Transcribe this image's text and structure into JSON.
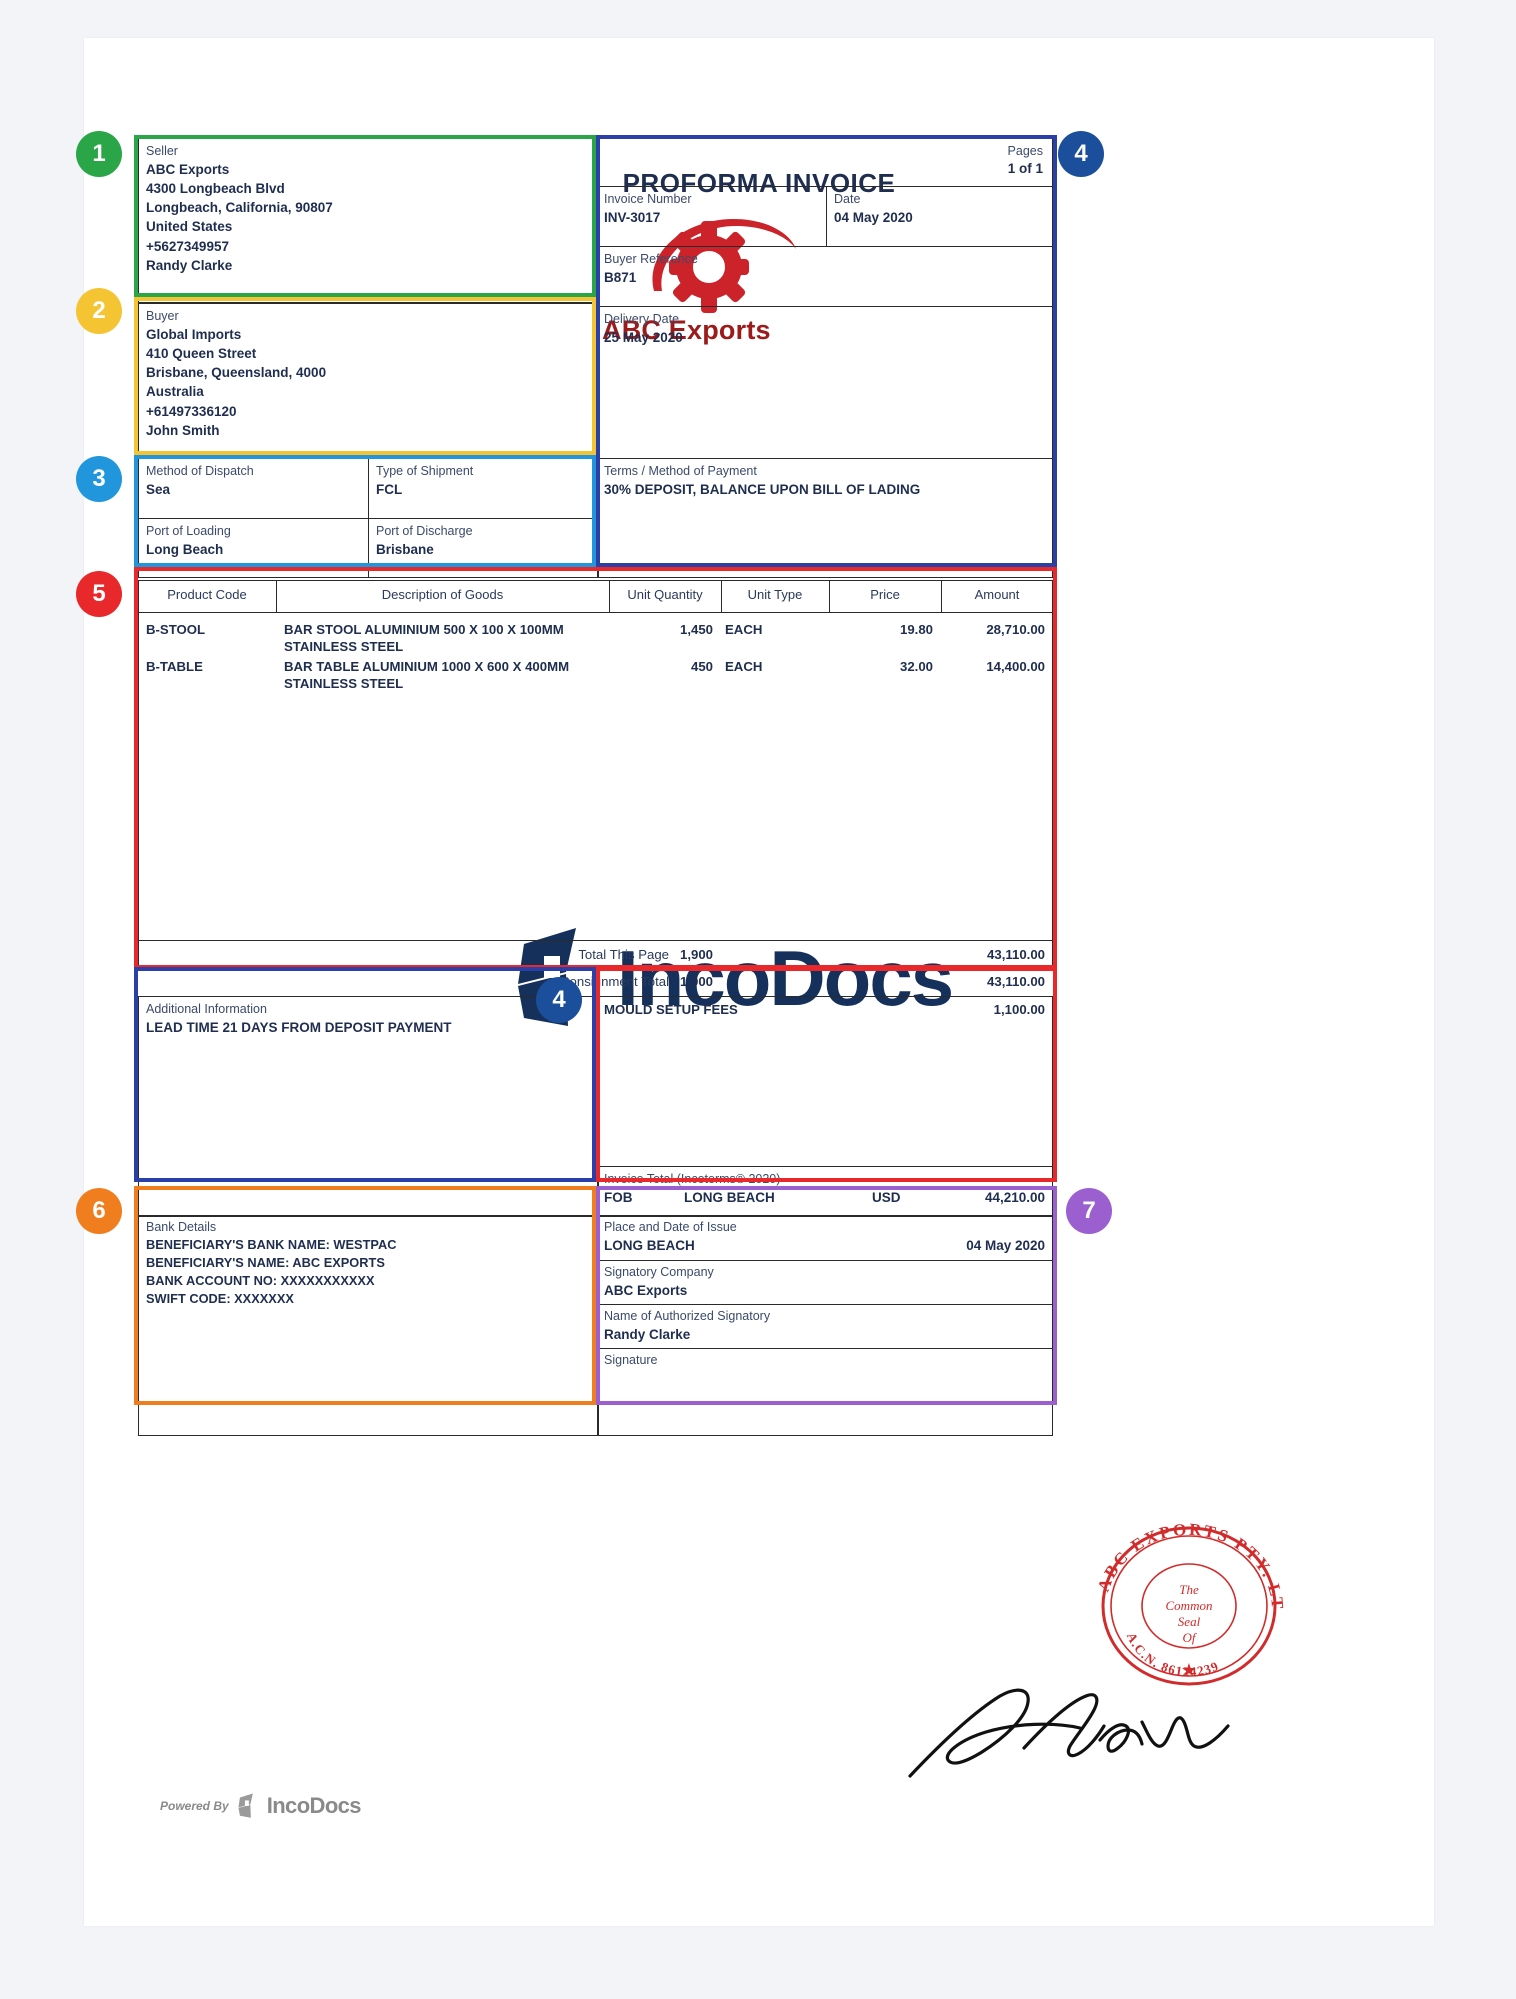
{
  "document": {
    "title": "PROFORMA INVOICE",
    "brand_name": "ABC Exports",
    "watermark": "IncoDocs",
    "footer_powered_by": "Powered By",
    "footer_brand": "IncoDocs"
  },
  "seller": {
    "label": "Seller",
    "lines": [
      "ABC Exports",
      "4300 Longbeach Blvd",
      "Longbeach, California, 90807",
      "United States",
      "+5627349957",
      "Randy Clarke"
    ]
  },
  "buyer": {
    "label": "Buyer",
    "lines": [
      "Global Imports",
      "410 Queen Street",
      "Brisbane, Queensland, 4000",
      "Australia",
      "+61497336120",
      "John Smith"
    ]
  },
  "shipping": {
    "method_of_dispatch": {
      "label": "Method of Dispatch",
      "value": "Sea"
    },
    "type_of_shipment": {
      "label": "Type of Shipment",
      "value": "FCL"
    },
    "port_of_loading": {
      "label": "Port of Loading",
      "value": "Long Beach"
    },
    "port_of_discharge": {
      "label": "Port of Discharge",
      "value": "Brisbane"
    }
  },
  "invoice_meta": {
    "pages_label": "Pages",
    "pages_value": "1 of 1",
    "invoice_number": {
      "label": "Invoice Number",
      "value": "INV-3017"
    },
    "date": {
      "label": "Date",
      "value": "04 May 2020"
    },
    "buyer_reference": {
      "label": "Buyer Reference",
      "value": "B871"
    },
    "delivery_date": {
      "label": "Delivery Date",
      "value": "25 May 2020"
    },
    "terms": {
      "label": "Terms / Method of Payment",
      "value": "30% DEPOSIT, BALANCE UPON BILL OF LADING"
    }
  },
  "items_table": {
    "headers": [
      "Product Code",
      "Description of Goods",
      "Unit Quantity",
      "Unit Type",
      "Price",
      "Amount"
    ],
    "rows": [
      {
        "product_code": "B-STOOL",
        "description_line1": "BAR STOOL ALUMINIUM 500 X 100 X 100MM",
        "description_line2": "STAINLESS STEEL",
        "unit_quantity": "1,450",
        "unit_type": "EACH",
        "price": "19.80",
        "amount": "28,710.00"
      },
      {
        "product_code": "B-TABLE",
        "description_line1": "BAR TABLE ALUMINIUM 1000 X 600 X 400MM",
        "description_line2": "STAINLESS STEEL",
        "unit_quantity": "450",
        "unit_type": "EACH",
        "price": "32.00",
        "amount": "14,400.00"
      }
    ],
    "total_this_page": {
      "label": "Total This Page",
      "quantity": "1,900",
      "amount": "43,110.00"
    },
    "consignment_total": {
      "label": "Consignment Total",
      "quantity": "1,900",
      "amount": "43,110.00"
    }
  },
  "additional_information": {
    "label": "Additional Information",
    "value": "LEAD TIME 21 DAYS FROM DEPOSIT PAYMENT"
  },
  "charges": {
    "mould_setup_label": "MOULD SETUP FEES",
    "mould_setup_amount": "1,100.00"
  },
  "invoice_total": {
    "label": "Invoice Total (Incoterms® 2020)",
    "incoterm": "FOB",
    "place": "LONG BEACH",
    "currency": "USD",
    "amount": "44,210.00"
  },
  "bank_details": {
    "label": "Bank Details",
    "lines": [
      "BENEFICIARY'S BANK NAME:  WESTPAC",
      "BENEFICIARY'S NAME:  ABC EXPORTS",
      "BANK ACCOUNT NO: XXXXXXXXXXX",
      "SWIFT CODE: XXXXXXX"
    ]
  },
  "issue": {
    "place_and_date_label": "Place and Date of Issue",
    "place": "LONG BEACH",
    "date": "04 May 2020",
    "signatory_company_label": "Signatory Company",
    "signatory_company": "ABC Exports",
    "signatory_name_label": "Name of Authorized Signatory",
    "signatory_name": "Randy   Clarke",
    "signature_label": "Signature"
  },
  "stamp": {
    "outer_text": "ABC EXPORTS PTY. LTD.",
    "inner_text": "A.C.N. 86124239",
    "center_lines": [
      "The",
      "Common",
      "Seal",
      "Of"
    ]
  },
  "annotations": [
    {
      "number": "1",
      "color": "#2aa648",
      "target": "seller-box"
    },
    {
      "number": "2",
      "color": "#f5c432",
      "target": "buyer-box"
    },
    {
      "number": "3",
      "color": "#2196dd",
      "target": "shipping-box"
    },
    {
      "number": "4",
      "color": "#1b4e9b",
      "target": "invoice-meta-box"
    },
    {
      "number": "5",
      "color": "#e8282a",
      "target": "items-box"
    },
    {
      "number": "4",
      "color": "#1b4e9b",
      "target": "additional-info-box"
    },
    {
      "number": "6",
      "color": "#f07d1e",
      "target": "bank-details-box"
    },
    {
      "number": "7",
      "color": "#9b5fd0",
      "target": "signature-box"
    }
  ]
}
